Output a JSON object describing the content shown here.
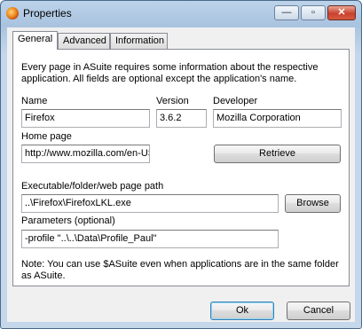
{
  "window": {
    "title": "Properties",
    "caption_buttons": {
      "minimize": "—",
      "maximize": "▫",
      "close": "✕"
    }
  },
  "tabs": [
    {
      "label": "General",
      "active": true
    },
    {
      "label": "Advanced",
      "active": false
    },
    {
      "label": "Information",
      "active": false
    }
  ],
  "general": {
    "intro": "Every page in ASuite requires some information about the respective application. All fields are optional except the application's name.",
    "name_label": "Name",
    "name_value": "Firefox",
    "version_label": "Version",
    "version_value": "3.6.2",
    "developer_label": "Developer",
    "developer_value": "Mozilla Corporation",
    "homepage_label": "Home page",
    "homepage_value": "http://www.mozilla.com/en-US",
    "retrieve_label": "Retrieve",
    "path_label": "Executable/folder/web page path",
    "path_value": "..\\Firefox\\FirefoxLKL.exe",
    "browse_label": "Browse",
    "params_label": "Parameters (optional)",
    "params_value": "-profile \"..\\..\\Data\\Profile_Paul\"",
    "note": "Note: You can use $ASuite even when applications are in the same folder as ASuite."
  },
  "footer": {
    "ok_label": "Ok",
    "cancel_label": "Cancel"
  }
}
